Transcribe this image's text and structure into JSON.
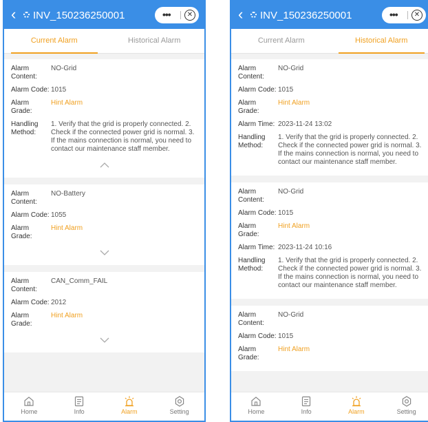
{
  "header": {
    "back_glyph": "‹",
    "device_title": "INV_150236250001",
    "more_glyph": "•••",
    "close_glyph": "✕"
  },
  "tabs": [
    "Current Alarm",
    "Historical Alarm"
  ],
  "labels": {
    "alarm_content": "Alarm Content:",
    "alarm_code": "Alarm Code:",
    "alarm_grade": "Alarm Grade:",
    "alarm_time": "Alarm Time:",
    "handling_method": "Handling Method:"
  },
  "current_alarms": [
    {
      "content": "NO-Grid",
      "code": "1015",
      "grade": "Hint Alarm",
      "method": "1. Verify that the grid is properly connected. 2. Check if the connected power grid is normal. 3. If the mains connection is normal, you need to contact our maintenance staff member."
    },
    {
      "content": "NO-Battery",
      "code": "1055",
      "grade": "Hint Alarm"
    },
    {
      "content": "CAN_Comm_FAIL",
      "code": "2012",
      "grade": "Hint Alarm"
    }
  ],
  "historical_alarms": [
    {
      "content": "NO-Grid",
      "code": "1015",
      "grade": "Hint Alarm",
      "time": "2023-11-24 13:02",
      "method": "1. Verify that the grid is properly connected. 2. Check if the connected power grid is normal. 3. If the mains connection is normal, you need to contact our maintenance staff member."
    },
    {
      "content": "NO-Grid",
      "code": "1015",
      "grade": "Hint Alarm",
      "time": "2023-11-24 10:16",
      "method": "1. Verify that the grid is properly connected. 2. Check if the connected power grid is normal. 3. If the mains connection is normal, you need to contact our maintenance staff member."
    },
    {
      "content": "NO-Grid",
      "code": "1015",
      "grade": "Hint Alarm"
    }
  ],
  "tabbar": [
    "Home",
    "Info",
    "Alarm",
    "Setting"
  ],
  "colors": {
    "header": "#3a8ee6",
    "accent": "#f0a020",
    "background": "#f2f2f2"
  },
  "icons": {
    "header": [
      "back-chevron-icon",
      "device-icon",
      "more-icon",
      "close-icon"
    ],
    "cards": [
      "chevron-up-icon",
      "chevron-down-icon"
    ],
    "tabbar": [
      "home-icon",
      "info-icon",
      "alarm-icon",
      "setting-icon"
    ]
  }
}
